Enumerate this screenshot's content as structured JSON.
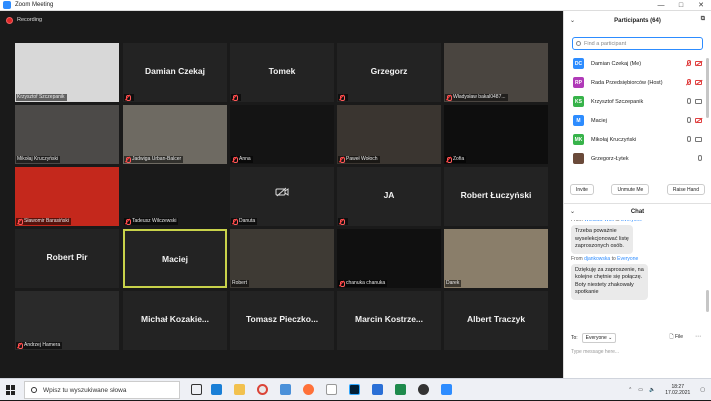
{
  "window": {
    "title": "Zoom Meeting",
    "controls": [
      "—",
      "□",
      "✕"
    ]
  },
  "recording": {
    "label": "Recording"
  },
  "tiles": [
    {
      "id": "t1",
      "big": "",
      "small": "Krzysztof Szczepanik",
      "muted": false,
      "video": true,
      "bg": "#d8d8d8"
    },
    {
      "id": "t2",
      "big": "Damian Czekaj",
      "small": "",
      "muted": true,
      "video": false
    },
    {
      "id": "t3",
      "big": "Tomek",
      "small": "",
      "muted": true,
      "video": false
    },
    {
      "id": "t4",
      "big": "Grzegorz",
      "small": "",
      "muted": true,
      "video": false
    },
    {
      "id": "t5",
      "big": "",
      "small": "Władysław bakal0487...",
      "muted": true,
      "video": true,
      "bg": "#4a4540"
    },
    {
      "id": "t6",
      "big": "",
      "small": "Mikołaj Kruczyński",
      "muted": false,
      "video": true,
      "bg": "#4c4a48"
    },
    {
      "id": "t7",
      "big": "",
      "small": "Jadwiga Urban-Balcer",
      "muted": true,
      "video": true,
      "bg": "#6e6a62"
    },
    {
      "id": "t8",
      "big": "",
      "small": "Anna",
      "muted": true,
      "video": true,
      "bg": "#141414"
    },
    {
      "id": "t9",
      "big": "",
      "small": "Paweł Wołoch",
      "muted": true,
      "video": true,
      "bg": "#3a3530"
    },
    {
      "id": "t10",
      "big": "",
      "small": "Zofia",
      "muted": true,
      "video": true,
      "bg": "#0e0e0e"
    },
    {
      "id": "t11",
      "big": "",
      "small": "Sławomir Barasiński",
      "muted": true,
      "video": true,
      "bg": "#c4281c"
    },
    {
      "id": "t12",
      "big": "",
      "small": "Tadeusz Wilczewski",
      "muted": true,
      "video": true,
      "bg": "#1a1a1a"
    },
    {
      "id": "t13",
      "big": "",
      "small": "Danuta",
      "muted": true,
      "video": false,
      "videoOff": true
    },
    {
      "id": "t14",
      "big": "JA",
      "small": "",
      "muted": true,
      "video": false
    },
    {
      "id": "t15",
      "big": "Robert Łuczyński",
      "small": "",
      "muted": false,
      "video": false
    },
    {
      "id": "t16",
      "big": "Robert Pir",
      "small": "",
      "muted": false,
      "video": false
    },
    {
      "id": "t17",
      "big": "Maciej",
      "small": "",
      "muted": false,
      "video": false,
      "active": true
    },
    {
      "id": "t18",
      "big": "",
      "small": "Robert",
      "muted": false,
      "video": true,
      "bg": "#3e3a34"
    },
    {
      "id": "t19",
      "big": "",
      "small": "chanuka chanuka",
      "muted": true,
      "video": true,
      "bg": "#101010"
    },
    {
      "id": "t20",
      "big": "",
      "small": "Darek",
      "muted": false,
      "video": true,
      "bg": "#8a7e6a"
    },
    {
      "id": "t21",
      "big": "",
      "small": "Andrzej Hamera",
      "muted": true,
      "video": true,
      "bg": "#2a2a2a"
    },
    {
      "id": "t22",
      "big": "Michał Kozakie...",
      "small": "",
      "muted": false,
      "video": false
    },
    {
      "id": "t23",
      "big": "Tomasz Pieczko...",
      "small": "",
      "muted": false,
      "video": false
    },
    {
      "id": "t24",
      "big": "Marcin Kostrze...",
      "small": "",
      "muted": false,
      "video": false
    },
    {
      "id": "t25",
      "big": "Albert Traczyk",
      "small": "",
      "muted": false,
      "video": false
    }
  ],
  "participants": {
    "title": "Participants (64)",
    "search_placeholder": "Find a participant",
    "list": [
      {
        "initials": "DC",
        "color": "#2d8cff",
        "name": "Damian Czekaj (Me)",
        "mic": "off",
        "cam": "off"
      },
      {
        "initials": "RP",
        "color": "#b03ab8",
        "name": "Rada Przedsiębiorców (Host)",
        "mic": "off",
        "cam": "off"
      },
      {
        "initials": "KS",
        "color": "#37b34a",
        "name": "Krzysztof Szczepanik",
        "mic": "on",
        "cam": "on"
      },
      {
        "initials": "M",
        "color": "#2d8cff",
        "name": "Maciej",
        "mic": "on",
        "cam": "off"
      },
      {
        "initials": "MK",
        "color": "#37b34a",
        "name": "Mikołaj Kruczyński",
        "mic": "on",
        "cam": "on"
      },
      {
        "initials": "",
        "color": "#6a4a3a",
        "name": "Grzegorz-Łytek",
        "mic": "on",
        "cam": "none"
      }
    ],
    "actions": [
      "Invite",
      "Unmute Me",
      "Raise Hand"
    ]
  },
  "chat": {
    "title": "Chat",
    "messages": [
      {
        "from": "Wiesław Wolf",
        "to": "Everyone",
        "text": "Trzeba poważnie\nwyselekcjonować listę\nzaproszonych osób."
      },
      {
        "from": "djankowska",
        "to": "Everyone",
        "text": "Dziękuję za zaproszenie, na\nkolejne chętnie się połączę.\nBoty niestety zhakowały\nspotkanie"
      }
    ],
    "from_word": "From",
    "to_word": "to",
    "to_label": "To:",
    "to_value": "Everyone",
    "file_label": "File",
    "placeholder": "Type message here..."
  },
  "taskbar": {
    "search_placeholder": "Wpisz tu wyszukiwane słowa",
    "time": "18:27",
    "date": "17.02.2021"
  }
}
